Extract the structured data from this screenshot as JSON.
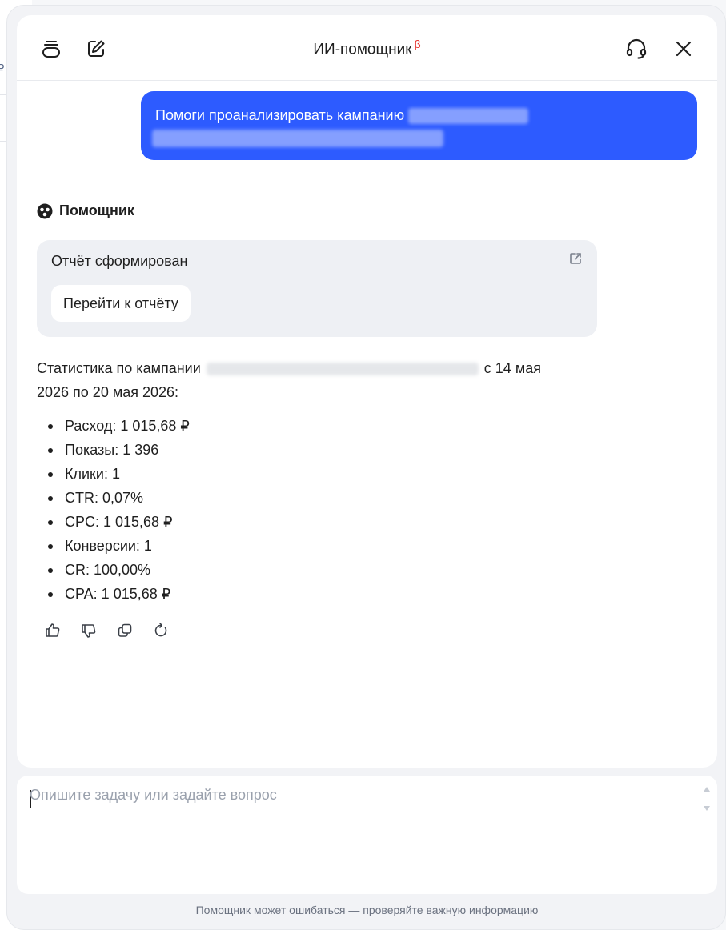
{
  "background_page": {
    "currency_glyph": "₽"
  },
  "header": {
    "title": "ИИ-помощник",
    "beta": "β"
  },
  "user_message": {
    "text": "Помоги проанализировать кампанию"
  },
  "assistant": {
    "label": "Помощник"
  },
  "report_card": {
    "title": "Отчёт сформирован",
    "button_label": "Перейти к отчёту"
  },
  "stats": {
    "intro_before": "Статистика по кампании",
    "intro_after": "с 14 мая 2026 по 20 мая 2026:",
    "items": [
      "Расход: 1 015,68 ₽",
      "Показы: 1 396",
      "Клики: 1",
      "CTR: 0,07%",
      "CPC: 1 015,68 ₽",
      "Конверсии: 1",
      "CR: 100,00%",
      "CPA: 1 015,68 ₽"
    ]
  },
  "input": {
    "placeholder": "Опишите задачу или задайте вопрос",
    "value": ""
  },
  "footer": {
    "note": "Помощник может ошибаться — проверяйте важную информацию"
  },
  "colors": {
    "accent": "#2d5bff",
    "beta": "#e5322d",
    "panel_bg": "#f2f3f6",
    "card_bg": "#eef0f4"
  },
  "icons": {
    "history": "stack-icon",
    "new_chat": "edit-icon",
    "support": "headset-icon",
    "close": "close-icon",
    "assistant": "assistant-logo-icon",
    "open_report": "external-link-icon",
    "like": "thumbs-up-icon",
    "dislike": "thumbs-down-icon",
    "copy": "copy-icon",
    "regenerate": "refresh-icon"
  }
}
